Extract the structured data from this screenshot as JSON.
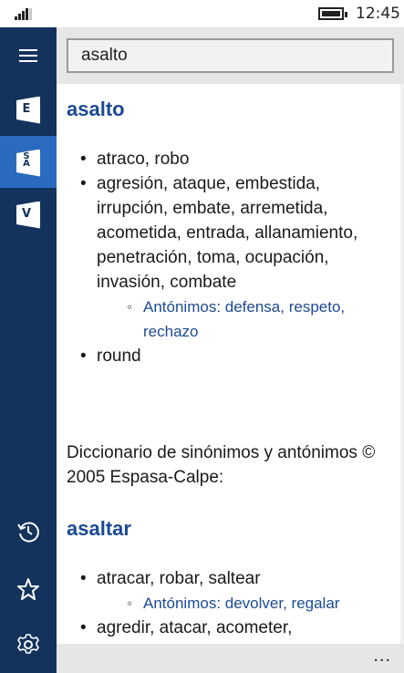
{
  "status_bar": {
    "time": "12:45"
  },
  "sidebar": {
    "items": [
      {
        "name": "menu",
        "label": ""
      },
      {
        "name": "dictionary-e",
        "label": "E"
      },
      {
        "name": "dictionary-sa",
        "label": "S A"
      },
      {
        "name": "dictionary-v",
        "label": "V"
      }
    ],
    "bottom": [
      "history",
      "favorites",
      "settings"
    ]
  },
  "search": {
    "value": "asalto"
  },
  "entries": [
    {
      "word": "asalto",
      "senses": [
        {
          "text": "atraco, robo"
        },
        {
          "text": "agresión, ataque, embestida, irrupción, embate, arremetida, acometida, entrada, allanamiento, penetración, toma, ocupación, invasión, combate",
          "antonyms": "Antónimos: defensa, respeto, rechazo"
        },
        {
          "text": "round"
        }
      ]
    },
    {
      "word": "asaltar",
      "senses": [
        {
          "text": "atracar, robar, saltear",
          "antonyms": "Antónimos: devolver, regalar"
        },
        {
          "text": "agredir, atacar, acometer,"
        }
      ]
    }
  ],
  "source": "Diccionario de sinónimos y antónimos © 2005 Espasa-Calpe:",
  "appbar": {
    "more": "..."
  }
}
